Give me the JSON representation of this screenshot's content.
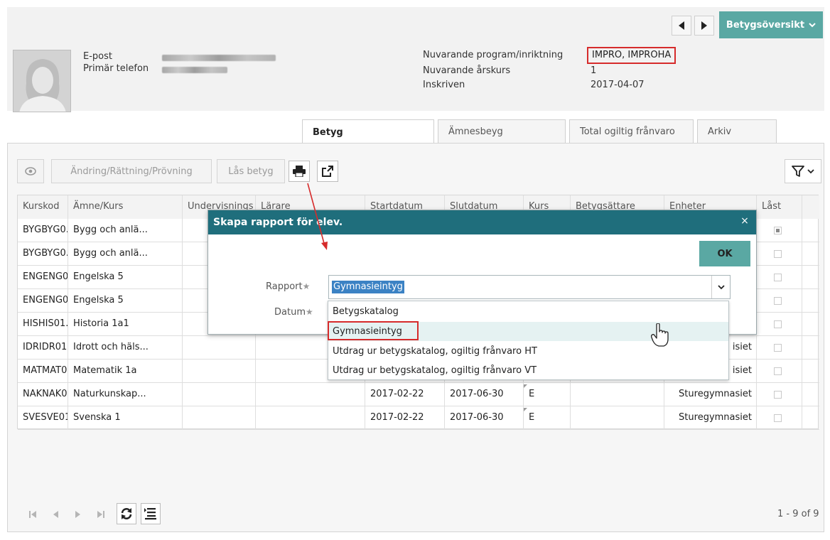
{
  "header": {
    "prev_label": "◀",
    "next_label": "▶",
    "overview_label": "Betygsöversikt",
    "email_label": "E-post",
    "phone_label": "Primär telefon",
    "program_label": "Nuvarande program/inriktning",
    "program_value": "IMPRO, IMPROHA",
    "year_label": "Nuvarande årskurs",
    "year_value": "1",
    "enrolled_label": "Inskriven",
    "enrolled_value": "2017-04-07"
  },
  "tabs": [
    {
      "label": "Betyg"
    },
    {
      "label": "Ämnesbeyg"
    },
    {
      "label": "Total ogiltig frånvaro"
    },
    {
      "label": "Arkiv"
    }
  ],
  "toolbar": {
    "change_label": "Ändring/Rättning/Prövning",
    "lock_label": "Lås betyg"
  },
  "table": {
    "columns": [
      "Kurskod",
      "Ämne/Kurs",
      "Undervisnings",
      "Lärare",
      "Startdatum",
      "Slutdatum",
      "Kurs",
      "Betygsättare",
      "Enheter",
      "Låst"
    ],
    "rows": [
      {
        "code": "BYGBYG0...",
        "course": "Bygg och anlä...",
        "start": "",
        "end": "",
        "grade": "",
        "unit": ""
      },
      {
        "code": "BYGBYG0...",
        "course": "Bygg och anlä...",
        "start": "",
        "end": "",
        "grade": "",
        "unit": ""
      },
      {
        "code": "ENGENG0...",
        "course": "Engelska 5",
        "start": "",
        "end": "",
        "grade": "",
        "unit": ""
      },
      {
        "code": "ENGENG0...",
        "course": "Engelska 5",
        "start": "",
        "end": "",
        "grade": "",
        "unit": ""
      },
      {
        "code": "HISHIS01...",
        "course": "Historia 1a1",
        "start": "",
        "end": "",
        "grade": "",
        "unit": ""
      },
      {
        "code": "IDRIDR01",
        "course": "Idrott och häls...",
        "start": "",
        "end": "",
        "grade": "",
        "unit": "isiet"
      },
      {
        "code": "MATMAT0...",
        "course": "Matematik 1a",
        "start": "",
        "end": "",
        "grade": "",
        "unit": "isiet"
      },
      {
        "code": "NAKNAK0...",
        "course": "Naturkunskap...",
        "start": "2017-02-22",
        "end": "2017-06-30",
        "grade": "E",
        "unit": "Sturegymnasiet"
      },
      {
        "code": "SVESVE01",
        "course": "Svenska 1",
        "start": "2017-02-22",
        "end": "2017-06-30",
        "grade": "E",
        "unit": "Sturegymnasiet"
      }
    ]
  },
  "pager": {
    "info": "1 - 9 of 9"
  },
  "modal": {
    "title": "Skapa rapport för elev.",
    "close_label": "×",
    "ok_label": "OK",
    "report_label": "Rapport",
    "date_label": "Datum",
    "required_mark": "★",
    "selected_value": "Gymnasieintyg",
    "options": [
      "Betygskatalog",
      "Gymnasieintyg",
      "Utdrag ur betygskatalog, ogiltig frånvaro HT",
      "Utdrag ur betygskatalog, ogiltig frånvaro VT"
    ]
  },
  "icons": {
    "eye": "eye-icon",
    "print": "printer-icon",
    "export": "export-icon",
    "filter": "filter-icon",
    "refresh": "refresh-icon",
    "columns": "column-settings-icon",
    "cursor": "hand-cursor-icon"
  },
  "colors": {
    "accent": "#5aa8a3",
    "modal_header": "#1f6e7c",
    "highlight_red": "#d62b2b",
    "selection_blue": "#3b82c4"
  }
}
